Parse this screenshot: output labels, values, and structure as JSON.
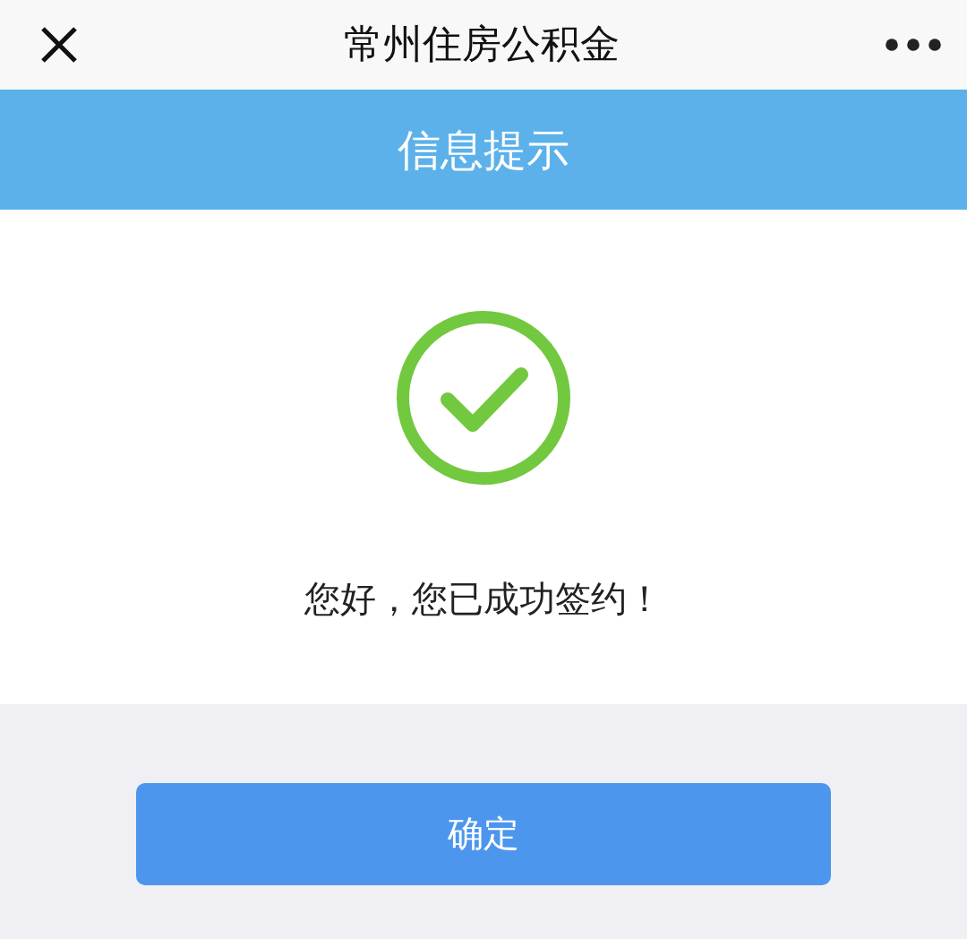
{
  "nav": {
    "title": "常州住房公积金"
  },
  "header": {
    "title": "信息提示"
  },
  "result": {
    "kind": "success",
    "message": "您好，您已成功签约！"
  },
  "buttons": [
    {
      "label": "确定"
    }
  ]
}
